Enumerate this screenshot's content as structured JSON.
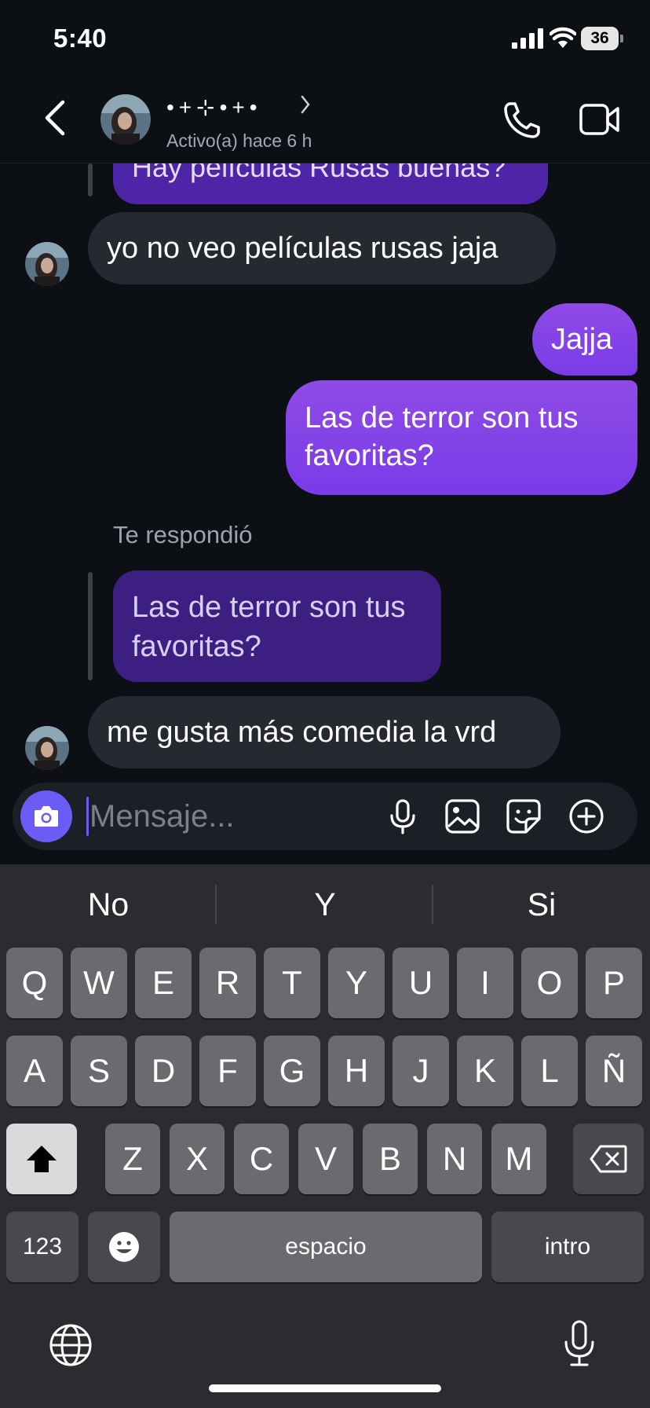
{
  "status_bar": {
    "time": "5:40",
    "battery": "36",
    "battery_level": 0.36
  },
  "header": {
    "contact_name": "•+⊹•+•",
    "activity": "Activo(a) hace 6 h"
  },
  "messages": [
    {
      "type": "sent_quoted_partial",
      "text": "Hay películas Rusas buenas?"
    },
    {
      "type": "received",
      "text": "yo no veo películas rusas jaja"
    },
    {
      "type": "sent",
      "text": "Jajja"
    },
    {
      "type": "sent",
      "text": "Las de terror son tus favoritas?"
    },
    {
      "type": "reply_label",
      "text": "Te respondió"
    },
    {
      "type": "quoted",
      "text": "Las de terror son tus favoritas?"
    },
    {
      "type": "received",
      "text": "me gusta más comedia la vrd"
    }
  ],
  "composer": {
    "placeholder": "Mensaje..."
  },
  "keyboard": {
    "suggestions": [
      "No",
      "Y",
      "Si"
    ],
    "row1": [
      "Q",
      "W",
      "E",
      "R",
      "T",
      "Y",
      "U",
      "I",
      "O",
      "P"
    ],
    "row2": [
      "A",
      "S",
      "D",
      "F",
      "G",
      "H",
      "J",
      "K",
      "L",
      "Ñ"
    ],
    "row3": [
      "Z",
      "X",
      "C",
      "V",
      "B",
      "N",
      "M"
    ],
    "numbers_key": "123",
    "space_key": "espacio",
    "return_key": "intro"
  },
  "icons": {
    "back": "chevron-left-icon",
    "call": "phone-icon",
    "video": "video-camera-icon",
    "camera": "camera-icon",
    "mic": "microphone-icon",
    "gallery": "image-icon",
    "sticker": "sticker-icon",
    "add": "plus-circle-icon",
    "shift": "shift-icon",
    "delete": "backspace-icon",
    "emoji": "emoji-icon",
    "globe": "globe-icon",
    "dictation": "microphone-icon"
  },
  "colors": {
    "accent": "#6a5cf5",
    "sent_bubble": "#8449e7",
    "quoted_bubble": "#3d1f82",
    "received_bubble": "#262930"
  }
}
